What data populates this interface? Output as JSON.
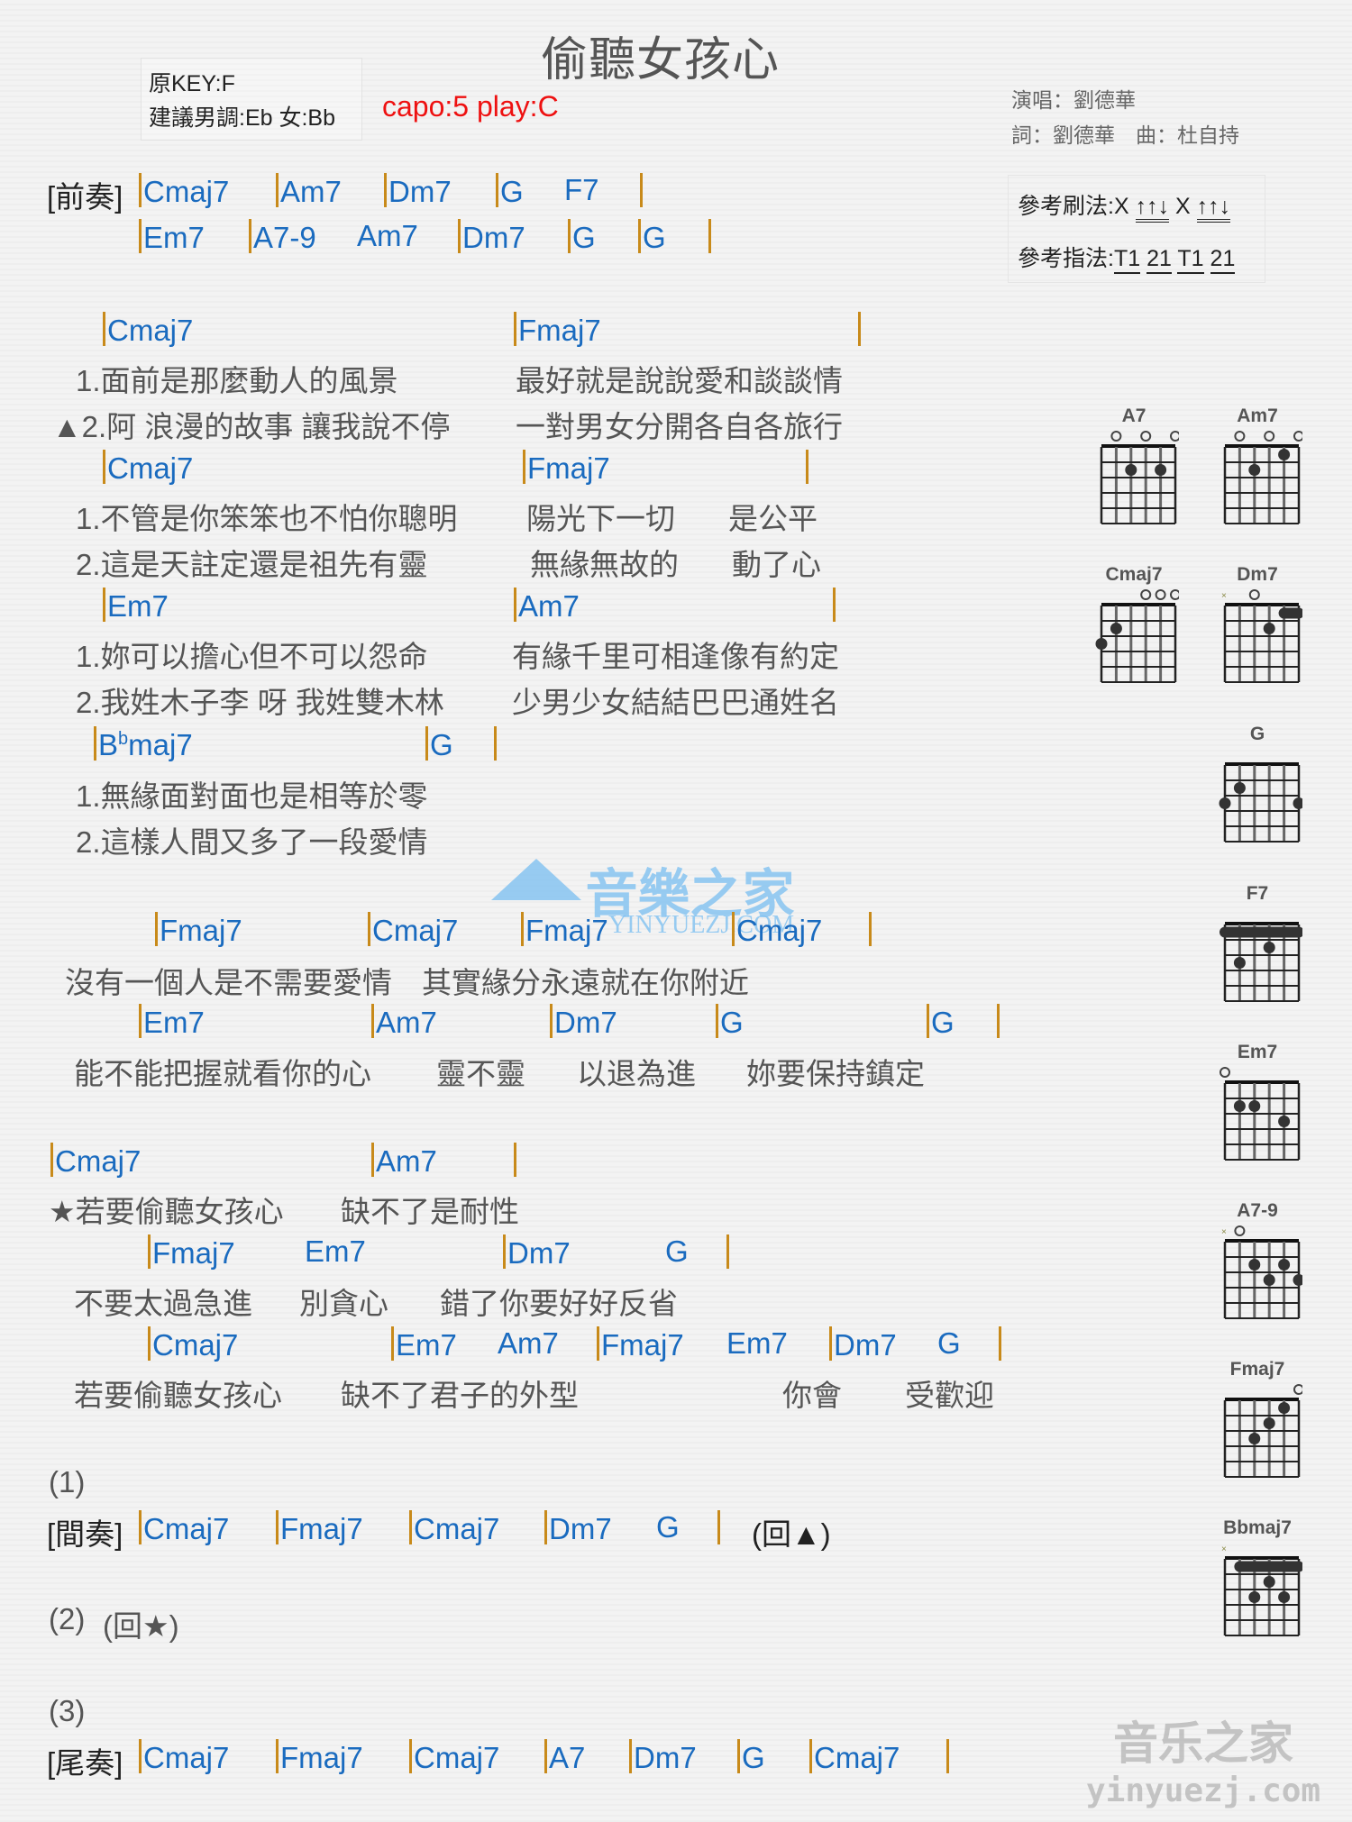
{
  "header": {
    "title": "偷聽女孩心",
    "original_key": "原KEY:F",
    "suggested_key": "建議男調:Eb 女:Bb",
    "capo": "capo:5 play:C",
    "singer": "演唱：劉德華",
    "lyricist_composer": "詞：劉德華　曲：杜自持",
    "strum_label": "參考刷法:X ",
    "strum_a": "↑↑↓",
    "strum_x": " X ",
    "strum_b": "↑↑↓",
    "finger_label": "參考指法:",
    "finger_pattern": [
      "T1",
      "21",
      "T1",
      "21"
    ]
  },
  "intro": {
    "label": "[前奏]",
    "row1": [
      "Cmaj7",
      "Am7",
      "Dm7",
      "G",
      "F7"
    ],
    "row2": [
      "Em7",
      "A7-9",
      "Am7",
      "Dm7",
      "G",
      "G"
    ]
  },
  "verse": [
    {
      "chords": [
        "Cmaj7",
        "Fmaj7"
      ],
      "l1": [
        "1.面前是那麼動人的風景",
        "最好就是說說愛和談談情"
      ],
      "l2": [
        "▲2.阿 浪漫的故事 讓我說不停",
        "一對男女分開各自各旅行"
      ]
    },
    {
      "chords": [
        "Cmaj7",
        "Fmaj7"
      ],
      "l1": [
        "1.不管是你笨笨也不怕你聰明",
        "陽光下一切",
        "是公平"
      ],
      "l2": [
        "2.這是天註定還是祖先有靈",
        "無緣無故的",
        "動了心"
      ]
    },
    {
      "chords": [
        "Em7",
        "Am7"
      ],
      "l1": [
        "1.妳可以擔心但不可以怨命",
        "有緣千里可相逢像有約定"
      ],
      "l2": [
        "2.我姓木子李 呀 我姓雙木林",
        "少男少女結結巴巴通姓名"
      ]
    },
    {
      "chords": [
        "B",
        "b",
        "maj7",
        "G"
      ],
      "l1": [
        "1.無緣面對面也是相等於零"
      ],
      "l2": [
        "2.這樣人間又多了一段愛情"
      ]
    }
  ],
  "prechorus": {
    "chords1": [
      "Fmaj7",
      "Cmaj7",
      "Fmaj7",
      "Cmaj7"
    ],
    "lyric1": "沒有一個人是不需要愛情　其實緣分永遠就在你附近",
    "chords2": [
      "Em7",
      "Am7",
      "Dm7",
      "G",
      "G"
    ],
    "lyric2": [
      "能不能把握就看你的心",
      "靈不靈",
      "以退為進",
      "妳要保持鎮定"
    ]
  },
  "chorus": {
    "chords1": [
      "Cmaj7",
      "Am7"
    ],
    "lyric1": [
      "★若要偷聽女孩心",
      "缺不了是耐性"
    ],
    "chords2": [
      "Fmaj7",
      "Em7",
      "Dm7",
      "G"
    ],
    "lyric2": [
      "不要太過急進",
      "別貪心",
      "錯了你要好好反省"
    ],
    "chords3": [
      "Cmaj7",
      "Em7",
      "Am7",
      "Fmaj7",
      "Em7",
      "Dm7",
      "G"
    ],
    "lyric3": [
      "若要偷聽女孩心",
      "缺不了君子的外型",
      "你會",
      "受歡迎"
    ]
  },
  "ending": {
    "mark1": "(1)",
    "interlude_label": "[間奏]",
    "interlude": [
      "Cmaj7",
      "Fmaj7",
      "Cmaj7",
      "Dm7",
      "G"
    ],
    "interlude_return": "(回▲)",
    "mark2": "(2)",
    "return_star": "(回★)",
    "mark3": "(3)",
    "outro_label": "[尾奏]",
    "outro": [
      "Cmaj7",
      "Fmaj7",
      "Cmaj7",
      "A7",
      "Dm7",
      "G",
      "Cmaj7"
    ]
  },
  "chord_diagrams": [
    {
      "name": "A7",
      "open": [
        2,
        4,
        6
      ],
      "mute": [],
      "dots": [
        [
          3,
          2
        ],
        [
          5,
          2
        ]
      ],
      "barre": null
    },
    {
      "name": "Am7",
      "open": [
        2,
        4,
        6
      ],
      "mute": [],
      "dots": [
        [
          3,
          2
        ],
        [
          5,
          1
        ]
      ],
      "barre": null
    },
    {
      "name": "Cmaj7",
      "open": [
        4,
        5,
        6
      ],
      "mute": [],
      "dots": [
        [
          1,
          3
        ],
        [
          2,
          2
        ]
      ],
      "barre": null
    },
    {
      "name": "Dm7",
      "open": [
        3
      ],
      "mute": [
        1
      ],
      "dots": [
        [
          4,
          2
        ]
      ],
      "barre": [
        5,
        6,
        1
      ]
    },
    {
      "name": "G",
      "open": [],
      "mute": [],
      "dots": [
        [
          2,
          2
        ],
        [
          1,
          3
        ],
        [
          6,
          3
        ]
      ],
      "barre": null
    },
    {
      "name": "F7",
      "open": [],
      "mute": [],
      "dots": [
        [
          4,
          2
        ],
        [
          2,
          3
        ]
      ],
      "barre": [
        1,
        6,
        1
      ]
    },
    {
      "name": "Em7",
      "open": [
        1
      ],
      "mute": [],
      "dots": [
        [
          2,
          2
        ],
        [
          3,
          2
        ],
        [
          5,
          3
        ]
      ],
      "barre": null
    },
    {
      "name": "A7-9",
      "open": [
        2
      ],
      "mute": [
        1
      ],
      "dots": [
        [
          3,
          2
        ],
        [
          5,
          2
        ],
        [
          4,
          3
        ],
        [
          6,
          3
        ]
      ],
      "barre": null
    },
    {
      "name": "Fmaj7",
      "open": [
        6
      ],
      "mute": [],
      "dots": [
        [
          5,
          1
        ],
        [
          4,
          2
        ],
        [
          3,
          3
        ]
      ],
      "barre": null
    },
    {
      "name": "Bbmaj7",
      "open": [],
      "mute": [
        1
      ],
      "dots": [
        [
          4,
          2
        ],
        [
          3,
          3
        ],
        [
          5,
          3
        ]
      ],
      "barre": [
        2,
        6,
        1
      ]
    }
  ],
  "watermark": {
    "center_text": "音樂之家",
    "center_sub": "YINYUEZJ.COM",
    "corner_text": "音乐之家",
    "corner_sub": "yinyuezj.com"
  }
}
